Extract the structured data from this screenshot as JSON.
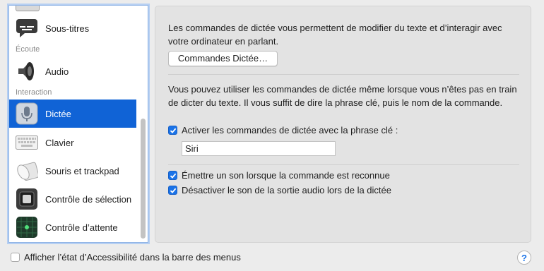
{
  "sidebar": {
    "items": [
      {
        "label": "Sous-titres",
        "icon": "subtitles-icon"
      },
      {
        "label": "Audio",
        "icon": "speaker-icon"
      },
      {
        "label": "Dictée",
        "icon": "microphone-icon",
        "selected": true
      },
      {
        "label": "Clavier",
        "icon": "keyboard-icon"
      },
      {
        "label": "Souris et trackpad",
        "icon": "mouse-trackpad-icon"
      },
      {
        "label": "Contrôle de sélection",
        "icon": "switch-control-icon"
      },
      {
        "label": "Contrôle d’attente",
        "icon": "dwell-control-icon"
      }
    ],
    "sections": {
      "hearing": "Écoute",
      "interaction": "Interaction"
    }
  },
  "panel": {
    "intro_text": "Les commandes de dictée vous permettent de modifier du texte et d’interagir avec votre ordinateur en parlant.",
    "commands_button": "Commandes Dictée…",
    "info_text": "Vous pouvez utiliser les commandes de dictée même lorsque vous n’êtes pas en train de dicter du texte. Il vous suffit de dire la phrase clé, puis le nom de la commande.",
    "keyphrase_checkbox": {
      "label": "Activer les commandes de dictée avec la phrase clé :",
      "checked": true
    },
    "keyphrase_value": "Siri",
    "sound_checkbox": {
      "label": "Émettre un son lorsque la commande est reconnue",
      "checked": true
    },
    "mute_checkbox": {
      "label": "Désactiver le son de la sortie audio lors de la dictée",
      "checked": true
    }
  },
  "footer": {
    "menu_bar_checkbox": {
      "label": "Afficher l’état d’Accessibilité dans la barre des menus",
      "checked": false
    },
    "help": "?"
  },
  "colors": {
    "accent": "#1063d6",
    "checkbox": "#1a73e8"
  }
}
